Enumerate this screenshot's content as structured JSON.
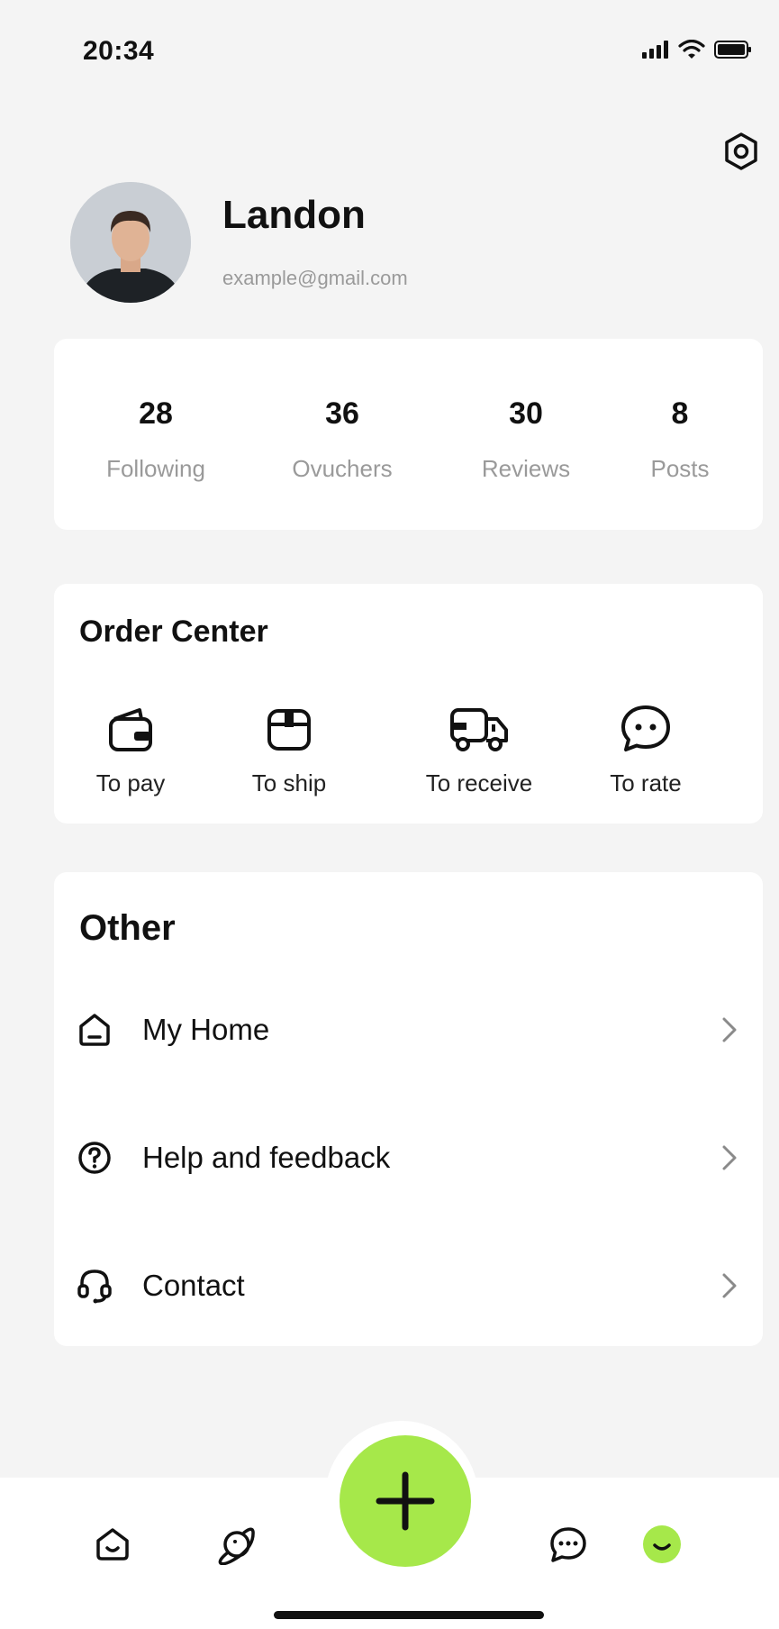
{
  "status_bar": {
    "time": "20:34"
  },
  "profile": {
    "name": "Landon",
    "email": "example@gmail.com"
  },
  "stats": [
    {
      "value": "28",
      "label": "Following"
    },
    {
      "value": "36",
      "label": "Ovuchers"
    },
    {
      "value": "30",
      "label": "Reviews"
    },
    {
      "value": "8",
      "label": "Posts"
    }
  ],
  "order_center": {
    "title": "Order Center",
    "items": [
      {
        "label": "To pay",
        "icon": "wallet-icon"
      },
      {
        "label": "To ship",
        "icon": "box-icon"
      },
      {
        "label": "To receive",
        "icon": "truck-icon"
      },
      {
        "label": "To rate",
        "icon": "chat-bubble-icon"
      }
    ]
  },
  "other": {
    "title": "Other",
    "items": [
      {
        "label": "My Home",
        "icon": "home-icon"
      },
      {
        "label": "Help and feedback",
        "icon": "help-icon"
      },
      {
        "label": "Contact",
        "icon": "headset-icon"
      }
    ]
  },
  "tab_bar": {
    "tabs": [
      "home-tab-icon",
      "planet-icon",
      "add-icon",
      "message-icon",
      "profile-icon"
    ]
  },
  "colors": {
    "accent": "#a6e84a",
    "background": "#f4f4f4",
    "card": "#ffffff",
    "muted_text": "#9a9a9a"
  }
}
